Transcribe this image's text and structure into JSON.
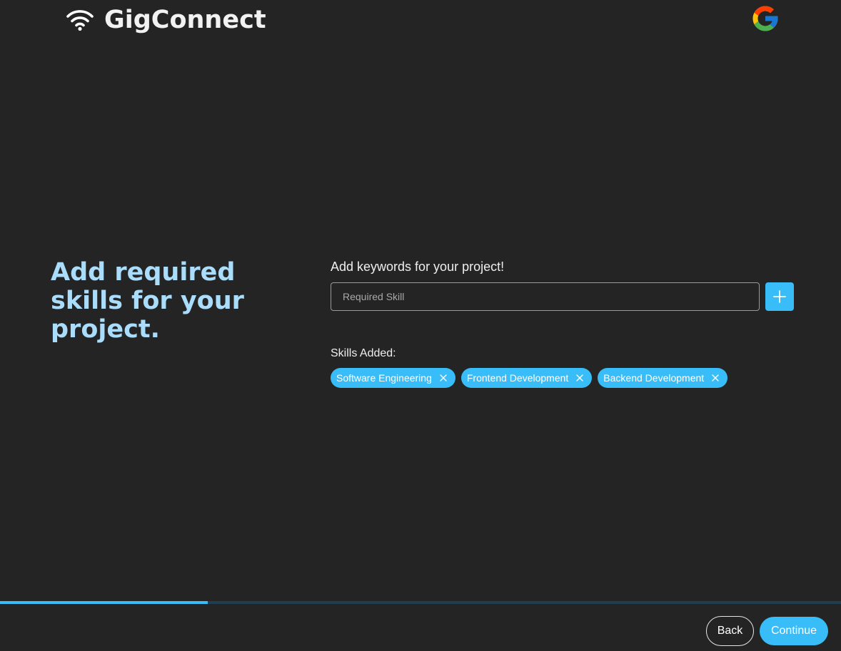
{
  "header": {
    "app_name": "GigConnect",
    "logo_icon": "wifi-icon",
    "account_icon": "google-icon"
  },
  "main": {
    "heading": "Add required skills for your project.",
    "keywords_label": "Add keywords for your project!",
    "skill_input": {
      "value": "",
      "placeholder": "Required Skill"
    },
    "add_button_icon": "plus-icon",
    "skills_added_label": "Skills Added:",
    "skills": [
      {
        "label": "Software Engineering",
        "remove_icon": "close-icon"
      },
      {
        "label": "Frontend Development",
        "remove_icon": "close-icon"
      },
      {
        "label": "Backend Development",
        "remove_icon": "close-icon"
      }
    ]
  },
  "progress": {
    "fraction": 0.247
  },
  "footer": {
    "back_label": "Back",
    "continue_label": "Continue"
  },
  "colors": {
    "background": "#242424",
    "accent": "#38bdf8",
    "heading": "#a9ddfb",
    "progress_track": "#1f3e52"
  }
}
